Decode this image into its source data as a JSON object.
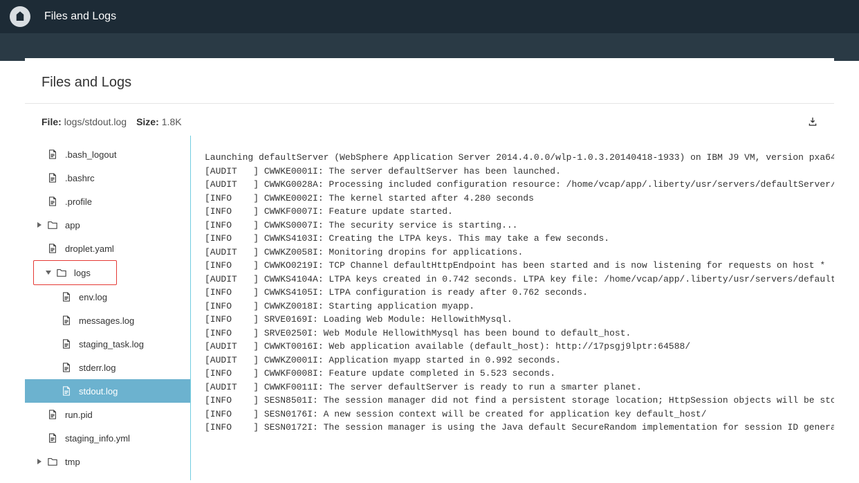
{
  "topbar": {
    "title": "Files and Logs"
  },
  "header": {
    "title": "Files and Logs"
  },
  "info": {
    "file_label": "File:",
    "file_value": "logs/stdout.log",
    "size_label": "Size:",
    "size_value": "1.8K"
  },
  "tree": {
    "items": [
      {
        "name": ".bash_logout",
        "type": "file",
        "indent": 0
      },
      {
        "name": ".bashrc",
        "type": "file",
        "indent": 0
      },
      {
        "name": ".profile",
        "type": "file",
        "indent": 0
      },
      {
        "name": "app",
        "type": "folder",
        "indent": 0,
        "caret": "right"
      },
      {
        "name": "droplet.yaml",
        "type": "file",
        "indent": 0
      },
      {
        "name": "logs",
        "type": "folder",
        "indent": 0,
        "caret": "down",
        "highlight": true
      },
      {
        "name": "env.log",
        "type": "file",
        "indent": 1
      },
      {
        "name": "messages.log",
        "type": "file",
        "indent": 1
      },
      {
        "name": "staging_task.log",
        "type": "file",
        "indent": 1
      },
      {
        "name": "stderr.log",
        "type": "file",
        "indent": 1
      },
      {
        "name": "stdout.log",
        "type": "file",
        "indent": 1,
        "selected": true
      },
      {
        "name": "run.pid",
        "type": "file",
        "indent": 0
      },
      {
        "name": "staging_info.yml",
        "type": "file",
        "indent": 0
      },
      {
        "name": "tmp",
        "type": "folder",
        "indent": 0,
        "caret": "right"
      }
    ]
  },
  "log": {
    "lines": [
      "Launching defaultServer (WebSphere Application Server 2014.4.0.0/wlp-1.0.3.20140418-1933) on IBM J9 VM, version pxa64",
      "[AUDIT   ] CWWKE0001I: The server defaultServer has been launched.",
      "[AUDIT   ] CWWKG0028A: Processing included configuration resource: /home/vcap/app/.liberty/usr/servers/defaultServer/",
      "[INFO    ] CWWKE0002I: The kernel started after 4.280 seconds",
      "[INFO    ] CWWKF0007I: Feature update started.",
      "[INFO    ] CWWKS0007I: The security service is starting...",
      "[INFO    ] CWWKS4103I: Creating the LTPA keys. This may take a few seconds.",
      "[AUDIT   ] CWWKZ0058I: Monitoring dropins for applications.",
      "[INFO    ] CWWKO0219I: TCP Channel defaultHttpEndpoint has been started and is now listening for requests on host *",
      "[AUDIT   ] CWWKS4104A: LTPA keys created in 0.742 seconds. LTPA key file: /home/vcap/app/.liberty/usr/servers/default",
      "[INFO    ] CWWKS4105I: LTPA configuration is ready after 0.762 seconds.",
      "[INFO    ] CWWKZ0018I: Starting application myapp.",
      "[INFO    ] SRVE0169I: Loading Web Module: HellowithMysql.",
      "[INFO    ] SRVE0250I: Web Module HellowithMysql has been bound to default_host.",
      "[AUDIT   ] CWWKT0016I: Web application available (default_host): http://17psgj9lptr:64588/",
      "[AUDIT   ] CWWKZ0001I: Application myapp started in 0.992 seconds.",
      "[INFO    ] CWWKF0008I: Feature update completed in 5.523 seconds.",
      "[AUDIT   ] CWWKF0011I: The server defaultServer is ready to run a smarter planet.",
      "[INFO    ] SESN8501I: The session manager did not find a persistent storage location; HttpSession objects will be sto",
      "[INFO    ] SESN0176I: A new session context will be created for application key default_host/",
      "[INFO    ] SESN0172I: The session manager is using the Java default SecureRandom implementation for session ID genera"
    ]
  }
}
